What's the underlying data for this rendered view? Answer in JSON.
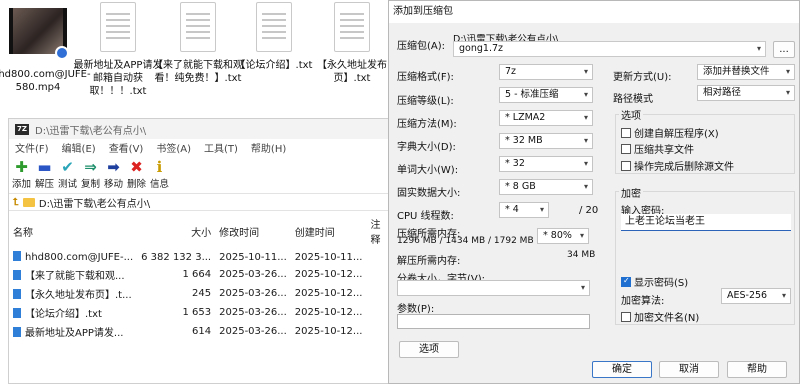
{
  "desktop": {
    "icons": [
      {
        "label": "hhd800.com@JUFE-580.mp4"
      },
      {
        "label": "最新地址及APP请发邮箱自动获取！！！.txt"
      },
      {
        "label": "【来了就能下载和观看！纯免费！】.txt"
      },
      {
        "label": "【论坛介绍】.txt"
      },
      {
        "label": "【永久地址发布页】.txt"
      }
    ]
  },
  "explorer": {
    "app_logo": "7Z",
    "title": "D:\\迅雷下载\\老公有点小\\",
    "menu": [
      "文件(F)",
      "编辑(E)",
      "查看(V)",
      "书签(A)",
      "工具(T)",
      "帮助(H)"
    ],
    "toolbar": [
      {
        "label": "添加",
        "icon": "plus-icon",
        "glyph": "✚",
        "color": "#2e9b2e"
      },
      {
        "label": "解压",
        "icon": "minus-icon",
        "glyph": "▬",
        "color": "#2a55c4"
      },
      {
        "label": "测试",
        "icon": "check-icon",
        "glyph": "✔",
        "color": "#2aa5b8"
      },
      {
        "label": "复制",
        "icon": "copy-arrows-icon",
        "glyph": "⇒",
        "color": "#1d8f6a"
      },
      {
        "label": "移动",
        "icon": "move-arrow-icon",
        "glyph": "➡",
        "color": "#1f3f9e"
      },
      {
        "label": "删除",
        "icon": "delete-x-icon",
        "glyph": "✖",
        "color": "#d22"
      },
      {
        "label": "信息",
        "icon": "info-icon",
        "glyph": "ℹ",
        "color": "#c89b00"
      }
    ],
    "path": "D:\\迅雷下载\\老公有点小\\",
    "columns": [
      "名称",
      "大小",
      "修改时间",
      "创建时间",
      "注释"
    ],
    "rows": [
      {
        "name": "hhd800.com@JUFE-...",
        "size": "6 382 132 3...",
        "modified": "2025-10-11...",
        "created": "2025-10-11...",
        "comment": ""
      },
      {
        "name": "【来了就能下载和观...",
        "size": "1 664",
        "modified": "2025-03-26...",
        "created": "2025-10-12...",
        "comment": ""
      },
      {
        "name": "【永久地址发布页】.t...",
        "size": "245",
        "modified": "2025-03-26...",
        "created": "2025-10-12...",
        "comment": ""
      },
      {
        "name": "【论坛介绍】.txt",
        "size": "1 653",
        "modified": "2025-03-26...",
        "created": "2025-10-12...",
        "comment": ""
      },
      {
        "name": "最新地址及APP请发...",
        "size": "614",
        "modified": "2025-03-26...",
        "created": "2025-10-12...",
        "comment": ""
      }
    ]
  },
  "dialog": {
    "title": "添加到压缩包",
    "archive_label": "压缩包(A):",
    "archive_dir": "D:\\迅雷下载\\老公有点小\\",
    "archive_name": "gong1.7z",
    "browse": "...",
    "format_label": "压缩格式(F):",
    "format_value": "7z",
    "level_label": "压缩等级(L):",
    "level_value": "5 - 标准压缩",
    "method_label": "压缩方法(M):",
    "method_value": "* LZMA2",
    "dict_label": "字典大小(D):",
    "dict_value": "* 32 MB",
    "word_label": "单词大小(W):",
    "word_value": "* 32",
    "solid_label": "固实数据大小:",
    "solid_value": "* 8 GB",
    "threads_label": "CPU 线程数:",
    "threads_value": "* 4",
    "threads_max": "/ 20",
    "mem_comp_label": "压缩所需内存:",
    "mem_comp_detail": "1296 MB / 1434 MB / 1792 MB",
    "mem_percent": "* 80%",
    "mem_decomp_label": "解压所需内存:",
    "mem_decomp_value": "34 MB",
    "split_label": "分卷大小，字节(V):",
    "split_value": "",
    "params_label": "参数(P):",
    "params_value": "",
    "options_button": "选项",
    "update_label": "更新方式(U):",
    "update_value": "添加并替换文件",
    "path_mode_label": "路径模式",
    "path_mode_value": "相对路径",
    "options_group": "选项",
    "opt_sfx": "创建自解压程序(X)",
    "opt_shared": "压缩共享文件",
    "opt_delete": "操作完成后删除源文件",
    "encrypt_group": "加密",
    "password_label": "输入密码:",
    "password_value": "上老王论坛当老王",
    "show_password": "显示密码(S)",
    "enc_method_label": "加密算法:",
    "enc_method_value": "AES-256",
    "enc_names": "加密文件名(N)",
    "ok": "确定",
    "cancel": "取消",
    "help": "帮助"
  }
}
